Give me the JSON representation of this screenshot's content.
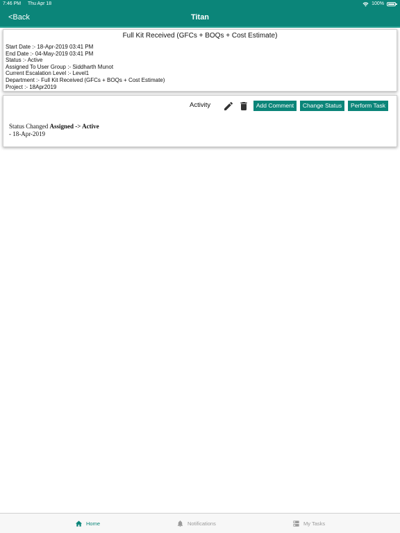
{
  "status_bar": {
    "time": "7:46 PM",
    "date": "Thu Apr 18",
    "battery": "100%"
  },
  "nav": {
    "back_label": "<Back",
    "title": "Titan"
  },
  "task_card": {
    "heading": "Full Kit Received (GFCs + BOQs + Cost Estimate)",
    "details": [
      "Start Date :- 18-Apr-2019 03:41 PM",
      "End Date :- 04-May-2019 03:41 PM",
      "Status :- Active",
      "Assigned To User Group :- Siddharth Munot",
      "Current Escalation Level :- Level1",
      "Department :- Full Kit Received (GFCs + BOQs + Cost Estimate)",
      "Project :- 18Apr2019"
    ]
  },
  "activity_card": {
    "label": "Activity",
    "buttons": {
      "add_comment": "Add Comment",
      "change_status": "Change Status",
      "perform_task": "Perform Task"
    },
    "entries": [
      {
        "prefix": "Status Changed ",
        "change": "Assigned -> Active",
        "date": "- 18-Apr-2019"
      }
    ]
  },
  "tab_bar": {
    "tabs": [
      {
        "label": "Home",
        "icon": "home-icon",
        "active": true
      },
      {
        "label": "Notifications",
        "icon": "bell-icon",
        "active": false
      },
      {
        "label": "My Tasks",
        "icon": "tasks-icon",
        "active": false
      }
    ]
  },
  "colors": {
    "brand": "#0b8579",
    "inactive_tab": "#9a9a9a"
  }
}
